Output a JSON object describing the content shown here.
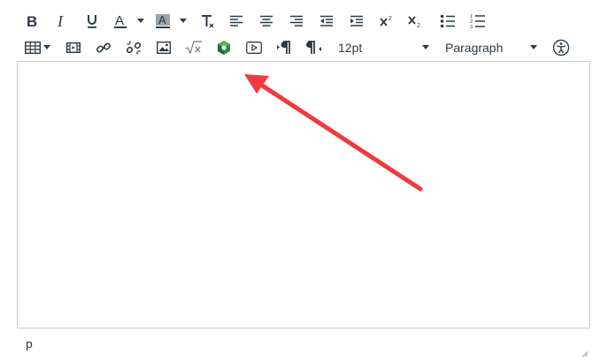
{
  "toolbar": {
    "font_size": {
      "value": "12pt"
    },
    "block_format": {
      "value": "Paragraph"
    }
  },
  "status_bar": {
    "path": "p"
  },
  "colors": {
    "icon": "#2d3b45",
    "border": "#c7cdd1",
    "arrow": "#f03a3e",
    "kaltura_green": "#2e8b3d"
  }
}
